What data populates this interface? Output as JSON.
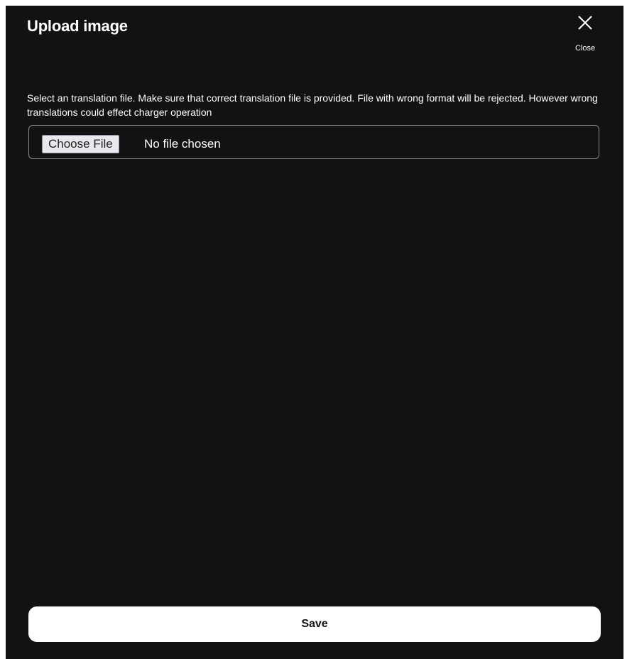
{
  "dialog": {
    "title": "Upload image",
    "close_label": "Close",
    "close_icon": "close-icon",
    "instructions": "Select an translation file. Make sure that correct translation file is provided. File with wrong format will be rejected. However wrong translations could effect charger operation",
    "file_input": {
      "button_label": "Choose File",
      "status_text": "No file chosen"
    },
    "save_label": "Save"
  },
  "colors": {
    "background": "#121212",
    "text": "#ffffff",
    "border": "#8a8a8a",
    "save_button_bg": "#ffffff",
    "save_button_text": "#111111"
  }
}
